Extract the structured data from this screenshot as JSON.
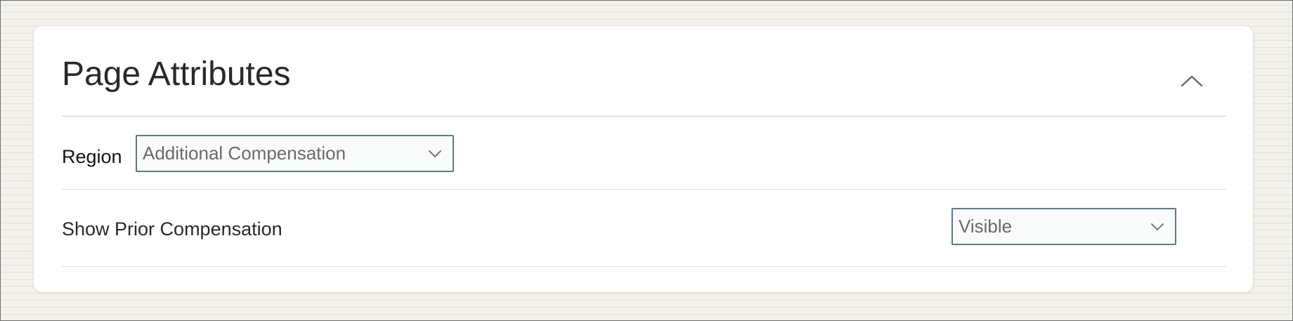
{
  "panel": {
    "title": "Page Attributes",
    "collapse_icon": "chevron-up-icon"
  },
  "region_field": {
    "label": "Region",
    "value": "Additional Compensation",
    "icon": "chevron-down-icon"
  },
  "prior_compensation_field": {
    "label": "Show Prior Compensation",
    "value": "Visible",
    "icon": "chevron-down-icon"
  },
  "colors": {
    "background": "#f3f1ec",
    "panel": "#ffffff",
    "select_border": "#5b7a88",
    "text": "#161513",
    "muted_text": "#6d6a66"
  }
}
